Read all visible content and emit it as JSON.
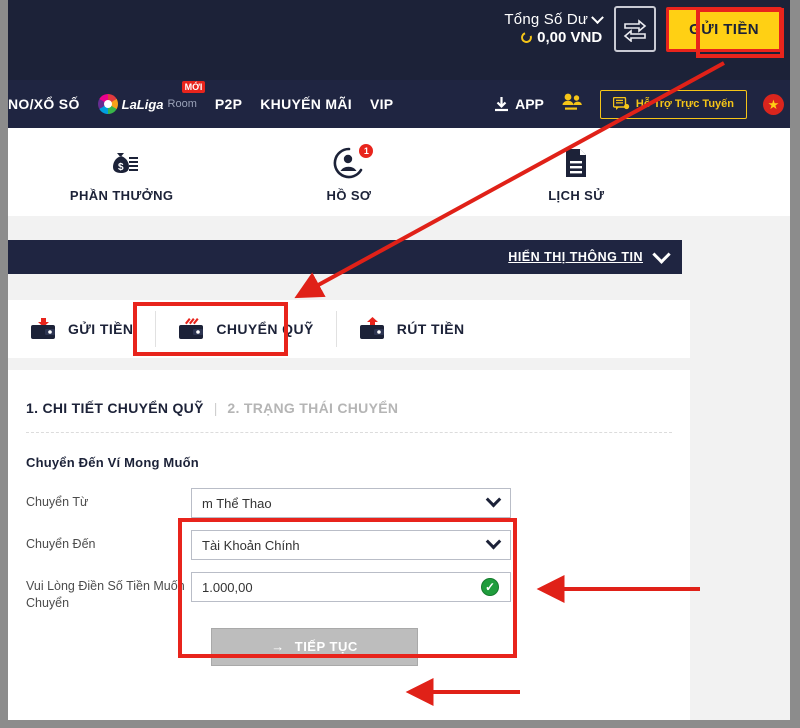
{
  "topbar": {
    "balance_label": "Tổng Số Dư",
    "balance_amount": "0,00 VND",
    "deposit_button": "GỬI TIỀN",
    "transfer_icon_name": "transfer-arrows-icon",
    "refresh_icon_name": "refresh-icon",
    "chevron_icon_name": "chevron-down-icon"
  },
  "nav": {
    "items": [
      {
        "label": "NO/XỔ SỐ"
      },
      {
        "label": "LaLiga",
        "sub": "Room",
        "badge": "MỚI"
      },
      {
        "label": "P2P"
      },
      {
        "label": "KHUYẾN MÃI"
      },
      {
        "label": "VIP"
      }
    ],
    "app_label": "APP",
    "support_label": "Hỗ Trợ Trực Tuyến",
    "flag_glyph": "★"
  },
  "quicklinks": [
    {
      "label": "PHẦN THƯỞNG",
      "icon": "money-bag-icon",
      "badge": ""
    },
    {
      "label": "HỒ SƠ",
      "icon": "user-profile-icon",
      "badge": "1"
    },
    {
      "label": "LỊCH SỬ",
      "icon": "document-history-icon",
      "badge": ""
    }
  ],
  "info_strip": {
    "label": "HIỂN THỊ THÔNG TIN",
    "chevron_icon": "chevron-down-icon"
  },
  "tabs": [
    {
      "label": "GỬI TIỀN",
      "icon": "wallet-deposit-icon",
      "active": false
    },
    {
      "label": "CHUYỂN QUỸ",
      "icon": "wallet-transfer-icon",
      "active": true
    },
    {
      "label": "RÚT TIỀN",
      "icon": "wallet-withdraw-icon",
      "active": false
    }
  ],
  "form": {
    "step_active": "1. CHI TIẾT CHUYỂN QUỸ",
    "step_separator": "|",
    "step_inactive": "2. TRẠNG THÁI CHUYỂN",
    "section_title": "Chuyển Đến Ví Mong Muốn",
    "rows": [
      {
        "label": "Chuyển Từ",
        "value": "m Thể Thao",
        "type": "select"
      },
      {
        "label": "Chuyển Đến",
        "value": "Tài Khoản Chính",
        "type": "select"
      },
      {
        "label": "Vui Lòng Điền Số Tiền Muốn Chuyển",
        "value": "1.000,00",
        "type": "text",
        "valid": true
      }
    ],
    "continue_button": "TIẾP TỤC",
    "continue_arrow": "→"
  },
  "colors": {
    "dark_navy": "#1c2238",
    "nav_navy": "#1f2541",
    "accent_yellow": "#ffd014",
    "annotation_red": "#e8241c",
    "support_gold": "#f5c518",
    "valid_green": "#1f9d3c",
    "disabled_gray": "#bdbdbd"
  }
}
